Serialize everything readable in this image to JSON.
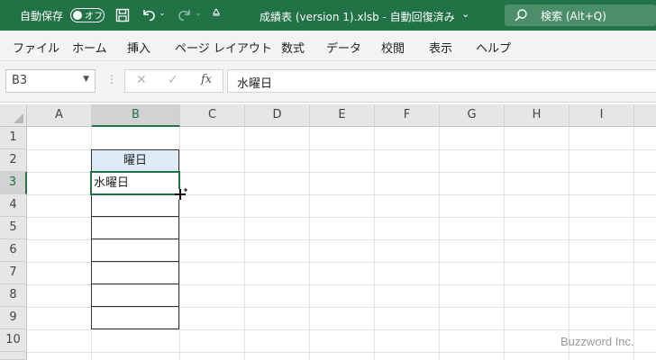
{
  "titlebar": {
    "autosave_label": "自動保存",
    "autosave_state": "オフ",
    "qat_more": "⩠",
    "doc_title": "成績表 (version 1).xlsb  -  自動回復済み",
    "doc_title_chevron": "⌄",
    "search_placeholder": "検索 (Alt+Q)"
  },
  "ribbon": {
    "tabs": [
      "ファイル",
      "ホーム",
      "挿入",
      "ページ レイアウト",
      "数式",
      "データ",
      "校閲",
      "表示",
      "ヘルプ"
    ]
  },
  "formula_bar": {
    "name_box": "B3",
    "dots": "⋮",
    "cancel_glyph": "✕",
    "enter_glyph": "✓",
    "fx_label": "fx",
    "formula_value": "水曜日"
  },
  "grid": {
    "columns": [
      "A",
      "B",
      "C",
      "D",
      "E",
      "F",
      "G",
      "H",
      "I"
    ],
    "selected_column": "B",
    "rows": [
      "1",
      "2",
      "3",
      "4",
      "5",
      "6",
      "7",
      "8",
      "9",
      "10"
    ],
    "selected_row": "3",
    "cells": {
      "B2": "曜日",
      "B3": "水曜日"
    }
  },
  "watermark": "Buzzword Inc.",
  "colors": {
    "accent": "#217346",
    "header_fill": "#ddebf7"
  }
}
